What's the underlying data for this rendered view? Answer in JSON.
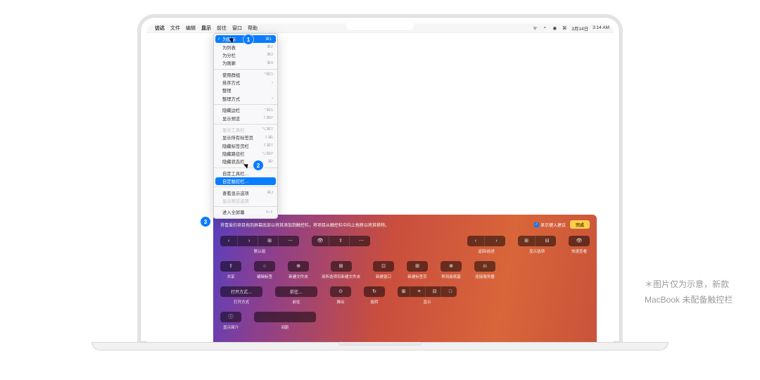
{
  "menubar": {
    "app": "访达",
    "items": [
      "文件",
      "编辑",
      "显示",
      "前往",
      "窗口",
      "帮助"
    ],
    "active_index": 2,
    "right": {
      "wifi_icon": "wifi",
      "search_icon": "search",
      "user_icon": "user",
      "cc_icon": "control-center",
      "date": "3月14日",
      "time": "3:14 AM"
    }
  },
  "dropdown": {
    "groups": [
      [
        {
          "label": "为图标",
          "shortcut": "⌘1",
          "checked": true,
          "highlight": true
        },
        {
          "label": "为列表",
          "shortcut": "⌘2"
        },
        {
          "label": "为分栏",
          "shortcut": "⌘3"
        },
        {
          "label": "为画廊",
          "shortcut": "⌘4"
        }
      ],
      [
        {
          "label": "使用群组",
          "shortcut": "^⌘O"
        },
        {
          "label": "排序方式",
          "submenu": true
        },
        {
          "label": "整理"
        },
        {
          "label": "整理方式",
          "submenu": true
        }
      ],
      [
        {
          "label": "隐藏边栏",
          "shortcut": "^⌘S"
        },
        {
          "label": "显示预览",
          "shortcut": "⇧⌘P"
        }
      ],
      [
        {
          "label": "显示工具栏",
          "shortcut": "⌥⌘T",
          "disabled": true
        },
        {
          "label": "显示所有标签页",
          "shortcut": "⇧⌘\\"
        },
        {
          "label": "隐藏标签页栏",
          "shortcut": "⇧⌘T"
        },
        {
          "label": "隐藏路径栏",
          "shortcut": "⌥⌘P"
        },
        {
          "label": "隐藏状态栏",
          "shortcut": "⌘/"
        }
      ],
      [
        {
          "label": "自定工具栏…"
        },
        {
          "label": "自定触控栏…",
          "highlight": true
        }
      ],
      [
        {
          "label": "查看显示选项",
          "shortcut": "⌘J"
        },
        {
          "label": "显示预览选项",
          "disabled": true
        }
      ],
      [
        {
          "label": "进入全屏幕",
          "shortcut": "fn F"
        }
      ]
    ]
  },
  "touchbar_panel": {
    "hint": "将喜爱的项目拖到屏幕底部以将其添加到触控栏，将项目从触控栏中向上拖移以将其移除。",
    "checkbox_label": "显示键入建议",
    "done": "完成",
    "rows": [
      [
        {
          "type": "group4",
          "segs": [
            "‹",
            "›",
            "⊞",
            "⋯"
          ],
          "label": "默认组"
        },
        {
          "type": "group3",
          "segs": [
            "👁",
            "⇪",
            "⋯"
          ],
          "label": ""
        },
        {
          "spacer": true
        },
        {
          "type": "group2",
          "segs": [
            "‹",
            "›"
          ],
          "label": "返回/前进"
        },
        {
          "type": "group2",
          "segs": [
            "⊞",
            "⊟"
          ],
          "label": "显示选项"
        },
        {
          "type": "single",
          "icon": "👁",
          "label": "快速查看"
        }
      ],
      [
        {
          "type": "single",
          "icon": "⇧",
          "label": "共享"
        },
        {
          "type": "single",
          "icon": "○",
          "label": "编辑标签"
        },
        {
          "type": "single",
          "icon": "⊕",
          "label": "新建文件夹"
        },
        {
          "type": "single",
          "icon": "⊞",
          "label": "用所选项目新建文件夹"
        },
        {
          "type": "single",
          "icon": "⊡",
          "label": "新建窗口"
        },
        {
          "type": "single",
          "icon": "⊞",
          "label": "新建标签页"
        },
        {
          "type": "single",
          "icon": "⊗",
          "label": "移到废纸篓"
        },
        {
          "type": "single",
          "icon": "⎌",
          "label": "连接服务器"
        }
      ],
      [
        {
          "type": "wide",
          "text": "打开方式…",
          "label": "打开方式"
        },
        {
          "type": "wide",
          "text": "前往…",
          "label": "前往"
        },
        {
          "type": "single",
          "icon": "⊙",
          "label": "推出"
        },
        {
          "type": "single",
          "icon": "↻",
          "label": "旋转"
        },
        {
          "type": "group4tight",
          "segs": [
            "⊞",
            "≡",
            "⊟",
            "□"
          ],
          "label": "显示"
        }
      ],
      [
        {
          "type": "single",
          "icon": "ⓘ",
          "label": "显示简介"
        },
        {
          "type": "xwide",
          "text": "",
          "label": "间距"
        }
      ]
    ]
  },
  "badges": {
    "b1": "1",
    "b2": "2",
    "b3": "3"
  },
  "caption": "＊图片仅为示意，新款 MacBook 未配备触控栏"
}
